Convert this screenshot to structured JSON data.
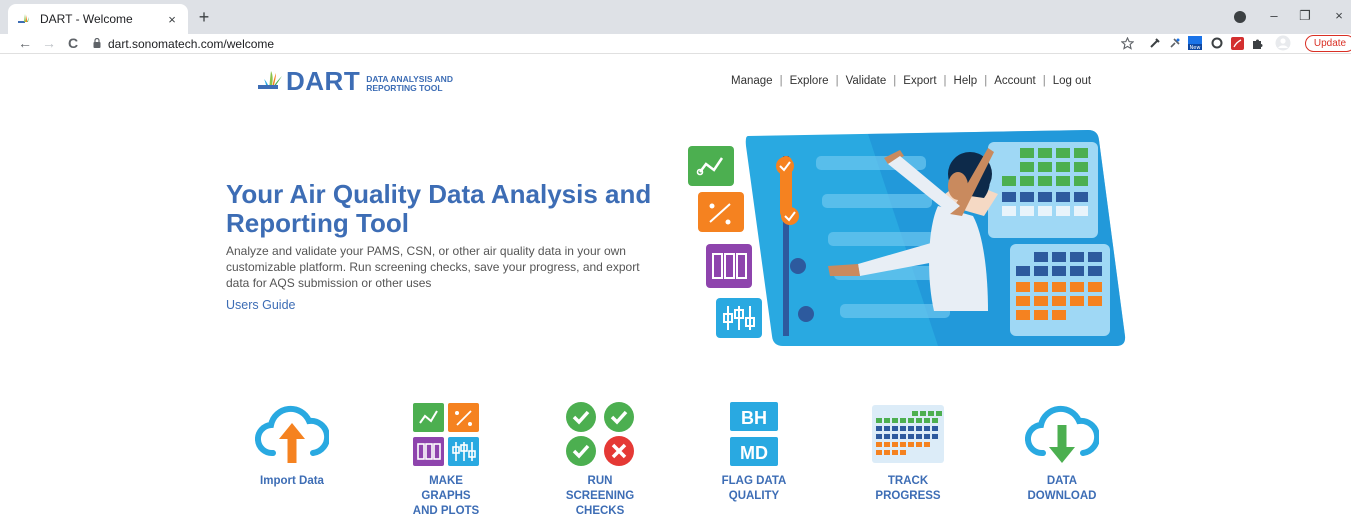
{
  "browser": {
    "tab_title": "DART - Welcome",
    "tab_close": "×",
    "new_tab": "+",
    "url": "dart.sonomatech.com/welcome",
    "update_label": "Update",
    "back_icon": "←",
    "forward_icon": "→",
    "reload_icon": "C",
    "minimize_icon": "–",
    "restore_icon": "❐",
    "close_icon": "×",
    "extensions": [
      "star-icon",
      "eyedropper-icon",
      "pin-icon",
      "new-badge-icon",
      "circle-icon",
      "pdf-icon",
      "puzzle-icon",
      "profile-icon"
    ]
  },
  "logo": {
    "name": "DART",
    "sub_line1": "DATA ANALYSIS AND",
    "sub_line2": "REPORTING TOOL"
  },
  "nav": {
    "items": [
      "Manage",
      "Explore",
      "Validate",
      "Export",
      "Help",
      "Account",
      "Log out"
    ],
    "separator": "|"
  },
  "hero": {
    "title": "Your Air Quality Data Analysis and Reporting Tool",
    "description": "Analyze and validate your PAMS, CSN, or other air quality data in your own customizable platform. Run screening checks, save your progress, and export data for AQS submission or other uses",
    "users_guide": "Users Guide"
  },
  "features": [
    {
      "icon": "cloud-upload-icon",
      "label": "Import Data"
    },
    {
      "icon": "graphs-plots-icon",
      "label": "MAKE\nGRAPHS\nAND PLOTS"
    },
    {
      "icon": "screening-checks-icon",
      "label": "RUN\nSCREENING\nCHECKS"
    },
    {
      "icon": "flag-quality-icon",
      "label": "FLAG DATA\nQUALITY",
      "badges": [
        "BH",
        "MD"
      ]
    },
    {
      "icon": "progress-grid-icon",
      "label": "TRACK\nPROGRESS"
    },
    {
      "icon": "cloud-download-icon",
      "label": "DATA\nDOWNLOAD"
    }
  ],
  "colors": {
    "brand_blue": "#3d6db5",
    "green": "#4caf50",
    "orange": "#f58220",
    "purple": "#8e44ad",
    "sky": "#29a9e1",
    "red": "#e53935"
  }
}
